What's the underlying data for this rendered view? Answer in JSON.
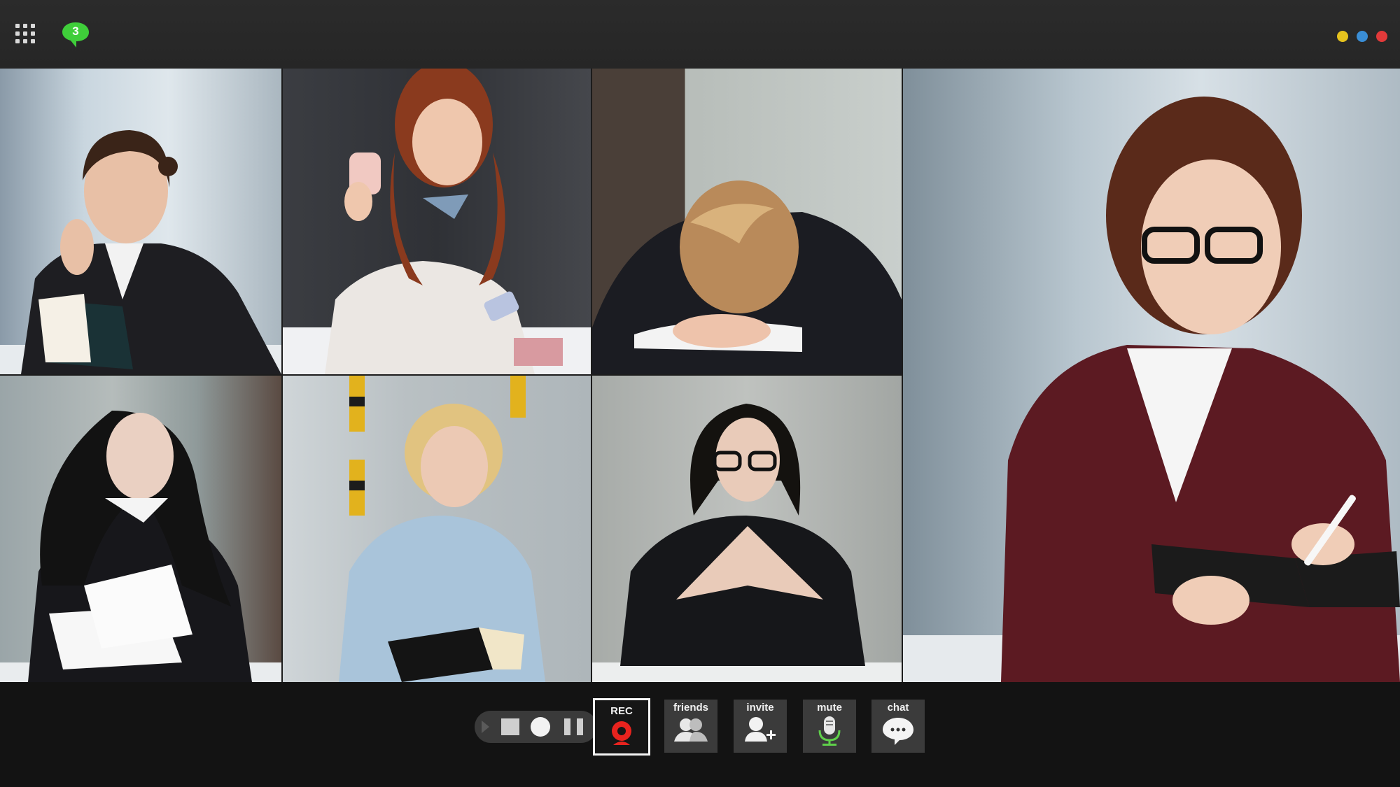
{
  "top_bar": {
    "chat_badge_count": "3",
    "window_dots": [
      "#e5c21e",
      "#3a8ed6",
      "#e23a3a"
    ],
    "icons": [
      "apps-grid-icon",
      "chat-bubble-icon"
    ]
  },
  "participants": [
    {
      "label": "participant-1",
      "state": "reading notebook"
    },
    {
      "label": "participant-2",
      "state": "holding mug"
    },
    {
      "label": "participant-3",
      "state": "head down on desk"
    },
    {
      "label": "participant-4",
      "state": "reading papers"
    },
    {
      "label": "participant-5",
      "state": "holding notebook"
    },
    {
      "label": "participant-6",
      "state": "hands clasped"
    },
    {
      "label": "participant-7",
      "state": "writing in notebook",
      "active_speaker": true
    }
  ],
  "controls": {
    "recorder": [
      "play-icon",
      "stop-icon",
      "record-dot-icon",
      "pause-icon"
    ],
    "rec_label": "REC",
    "friends_label": "friends",
    "invite_label": "invite",
    "mute_label": "mute",
    "chat_label": "chat"
  },
  "colors": {
    "rec_accent": "#e8231e",
    "mute_accent": "#5fd04a",
    "badge": "#3fce3a"
  }
}
